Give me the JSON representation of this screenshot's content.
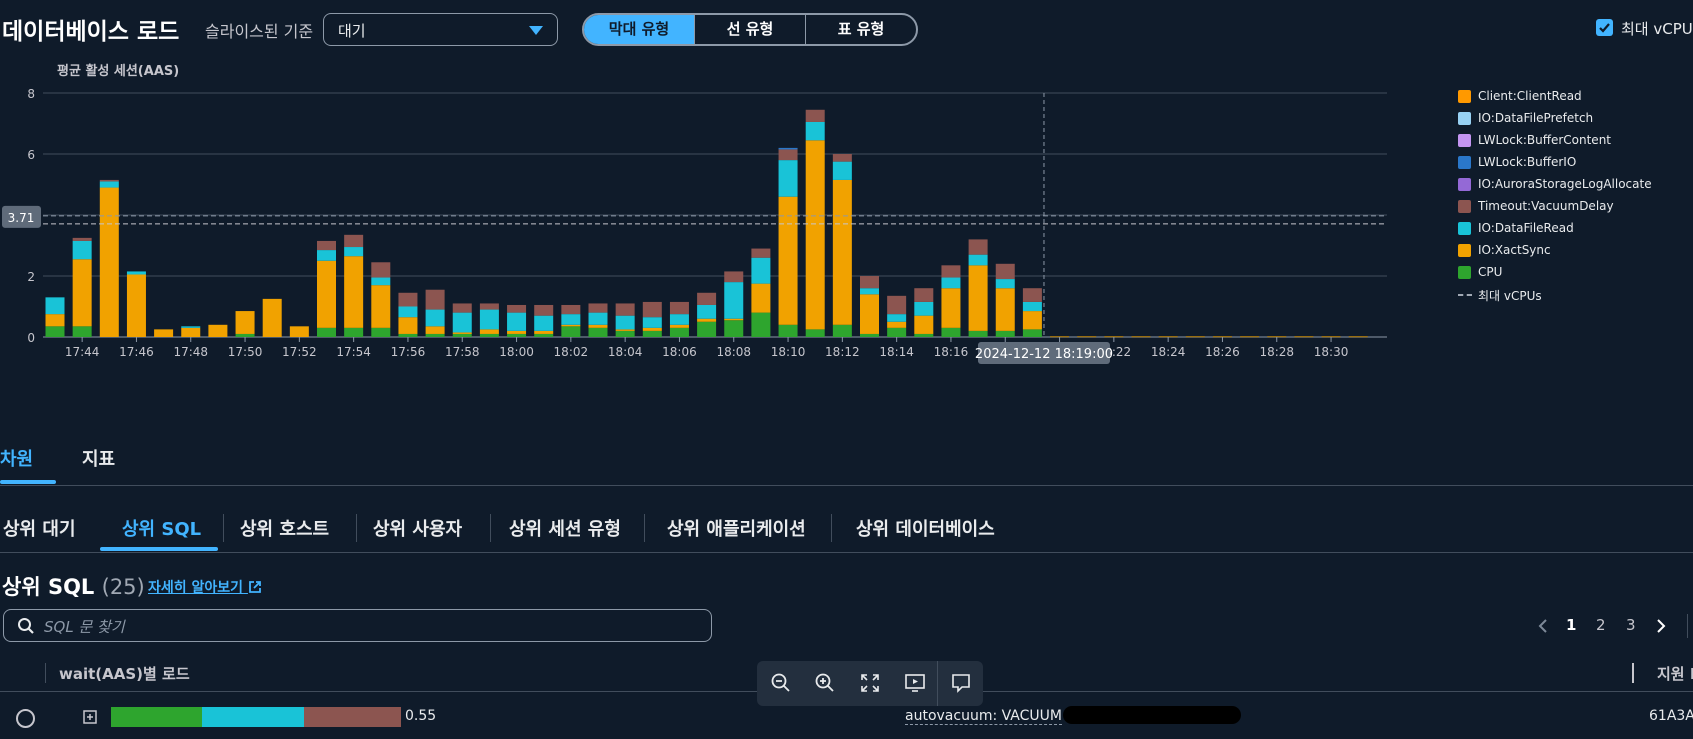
{
  "header": {
    "title": "데이터베이스 로드",
    "slice_label": "슬라이스된 기준",
    "slice_value": "대기",
    "view_options": [
      "막대 유형",
      "선 유형",
      "표 유형"
    ],
    "selected_view": "막대 유형",
    "vcpu_checkbox_label": "최대 vCPU",
    "vcpu_checked": true
  },
  "colors": {
    "accent": "#42b4ff",
    "background": "#0f1b2a"
  },
  "chart_data": {
    "type": "bar",
    "stacked": true,
    "ylabel": "평균 활성 세션(AAS)",
    "ylim": [
      0,
      8
    ],
    "yticks": [
      0,
      2,
      4,
      6,
      8
    ],
    "x_tick_labels": [
      "17:44",
      "17:46",
      "17:48",
      "17:50",
      "17:52",
      "17:54",
      "17:56",
      "17:58",
      "18:00",
      "18:02",
      "18:04",
      "18:06",
      "18:08",
      "18:10",
      "18:12",
      "18:14",
      "18:16",
      "18:18",
      "18:20",
      "18:22",
      "18:24",
      "18:26",
      "18:28",
      "18:30"
    ],
    "max_vcpu_line": 3.71,
    "max_vcpu_label": "3.71",
    "hover_tooltip": "2024-12-12 18:19:00",
    "hover_category": "18:19",
    "legend_position": "right",
    "categories": [
      "17:43",
      "17:44",
      "17:45",
      "17:46",
      "17:47",
      "17:48",
      "17:49",
      "17:50",
      "17:51",
      "17:52",
      "17:53",
      "17:54",
      "17:55",
      "17:56",
      "17:57",
      "17:58",
      "17:59",
      "18:00",
      "18:01",
      "18:02",
      "18:03",
      "18:04",
      "18:05",
      "18:06",
      "18:07",
      "18:08",
      "18:09",
      "18:10",
      "18:11",
      "18:12",
      "18:13",
      "18:14",
      "18:15",
      "18:16",
      "18:17",
      "18:18",
      "18:19",
      "18:20",
      "18:21",
      "18:22",
      "18:23",
      "18:24",
      "18:25",
      "18:26",
      "18:27",
      "18:28",
      "18:29",
      "18:30",
      "18:31"
    ],
    "series": [
      {
        "name": "CPU",
        "color": "#2ea52e",
        "values": [
          0.35,
          0.35,
          0.0,
          0.0,
          0.0,
          0.0,
          0.0,
          0.1,
          0.0,
          0.0,
          0.3,
          0.3,
          0.3,
          0.1,
          0.1,
          0.1,
          0.1,
          0.1,
          0.1,
          0.35,
          0.3,
          0.2,
          0.2,
          0.3,
          0.5,
          0.55,
          0.8,
          0.4,
          0.25,
          0.4,
          0.1,
          0.3,
          0.1,
          0.3,
          0.2,
          0.2,
          0.25,
          0,
          0,
          0,
          0,
          0,
          0,
          0,
          0,
          0,
          0,
          0,
          0
        ]
      },
      {
        "name": "IO:XactSync",
        "color": "#f1a200",
        "values": [
          0.4,
          2.2,
          4.9,
          2.05,
          0.25,
          0.3,
          0.4,
          0.75,
          1.25,
          0.35,
          2.2,
          2.35,
          1.4,
          0.55,
          0.25,
          0.05,
          0.15,
          0.1,
          0.1,
          0.05,
          0.1,
          0.05,
          0.1,
          0.1,
          0.1,
          0.05,
          0.95,
          4.2,
          6.2,
          4.75,
          1.3,
          0.2,
          0.6,
          1.3,
          2.15,
          1.4,
          0.6,
          0.02,
          0.02,
          0.02,
          0.02,
          0.02,
          0.02,
          0.02,
          0.02,
          0.02,
          0.02,
          0.02,
          0.02
        ]
      },
      {
        "name": "IO:DataFileRead",
        "color": "#19c3d7",
        "values": [
          0.55,
          0.6,
          0.2,
          0.1,
          0.0,
          0.05,
          0.0,
          0.0,
          0.0,
          0.0,
          0.35,
          0.3,
          0.25,
          0.35,
          0.55,
          0.65,
          0.65,
          0.6,
          0.5,
          0.35,
          0.4,
          0.45,
          0.35,
          0.35,
          0.45,
          1.2,
          0.85,
          1.2,
          0.6,
          0.6,
          0.2,
          0.25,
          0.45,
          0.35,
          0.35,
          0.3,
          0.3,
          0,
          0,
          0,
          0,
          0,
          0,
          0,
          0,
          0,
          0,
          0,
          0
        ]
      },
      {
        "name": "Timeout:VacuumDelay",
        "color": "#8c5550",
        "values": [
          0.0,
          0.1,
          0.05,
          0.0,
          0.0,
          0.0,
          0.0,
          0.0,
          0.0,
          0.0,
          0.3,
          0.4,
          0.5,
          0.45,
          0.65,
          0.3,
          0.2,
          0.25,
          0.35,
          0.3,
          0.3,
          0.4,
          0.5,
          0.4,
          0.4,
          0.35,
          0.3,
          0.35,
          0.4,
          0.25,
          0.4,
          0.6,
          0.45,
          0.4,
          0.5,
          0.5,
          0.45,
          0,
          0,
          0,
          0,
          0,
          0,
          0,
          0,
          0,
          0,
          0,
          0
        ]
      },
      {
        "name": "LWLock:BufferIO",
        "color": "#2a77c9",
        "values": [
          0,
          0,
          0,
          0,
          0,
          0,
          0,
          0,
          0,
          0,
          0,
          0,
          0,
          0,
          0,
          0,
          0,
          0,
          0,
          0,
          0,
          0,
          0,
          0,
          0,
          0,
          0,
          0.05,
          0,
          0,
          0,
          0,
          0,
          0,
          0,
          0,
          0,
          0,
          0,
          0,
          0,
          0,
          0,
          0,
          0,
          0,
          0,
          0,
          0
        ]
      },
      {
        "name": "LWLock:BufferContent",
        "color": "#c495f1",
        "values": []
      },
      {
        "name": "IO:DataFilePrefetch",
        "color": "#98d1f3",
        "values": []
      },
      {
        "name": "Client:ClientRead",
        "color": "#ff9900",
        "values": []
      },
      {
        "name": "IO:AuroraStorageLogAllocate",
        "color": "#9469d6",
        "values": []
      }
    ],
    "legend": [
      {
        "name": "Client:ClientRead",
        "color": "#ff9900"
      },
      {
        "name": "IO:DataFilePrefetch",
        "color": "#98d1f3"
      },
      {
        "name": "LWLock:BufferContent",
        "color": "#c495f1"
      },
      {
        "name": "LWLock:BufferIO",
        "color": "#2a77c9"
      },
      {
        "name": "IO:AuroraStorageLogAllocate",
        "color": "#9469d6"
      },
      {
        "name": "Timeout:VacuumDelay",
        "color": "#8c5550"
      },
      {
        "name": "IO:DataFileRead",
        "color": "#19c3d7"
      },
      {
        "name": "IO:XactSync",
        "color": "#f1a200"
      },
      {
        "name": "CPU",
        "color": "#2ea52e"
      },
      {
        "name": "최대 vCPUs",
        "color": "#a0a8b3",
        "dashed": true
      }
    ]
  },
  "tabs_primary": [
    "차원",
    "지표"
  ],
  "tabs_primary_selected": "차원",
  "tabs_secondary": [
    "상위 대기",
    "상위 SQL",
    "상위 호스트",
    "상위 사용자",
    "상위 세션 유형",
    "상위 애플리케이션",
    "상위 데이터베이스"
  ],
  "tabs_secondary_selected": "상위 SQL",
  "top_sql": {
    "title": "상위 SQL",
    "count": "(25)",
    "learn_more": "자세히 알아보기",
    "search_placeholder": "SQL 문 찾기",
    "pages": [
      "1",
      "2",
      "3"
    ],
    "current_page": "1",
    "columns": [
      "wait(AAS)별 로드",
      "지원 I"
    ],
    "rows": [
      {
        "load_value": "0.55",
        "load_segments": [
          {
            "value": 0.15,
            "color": "#2ea52e"
          },
          {
            "value": 0.17,
            "color": "#19c3d7"
          },
          {
            "value": 0.16,
            "color": "#8c5550"
          }
        ],
        "statement": "autovacuum: VACUUM",
        "support_id": "61A3A"
      }
    ]
  },
  "zoom_toolbar": [
    "zoom-out-icon",
    "zoom-in-icon",
    "fullscreen-icon",
    "slideshow-icon",
    "feedback-icon"
  ]
}
